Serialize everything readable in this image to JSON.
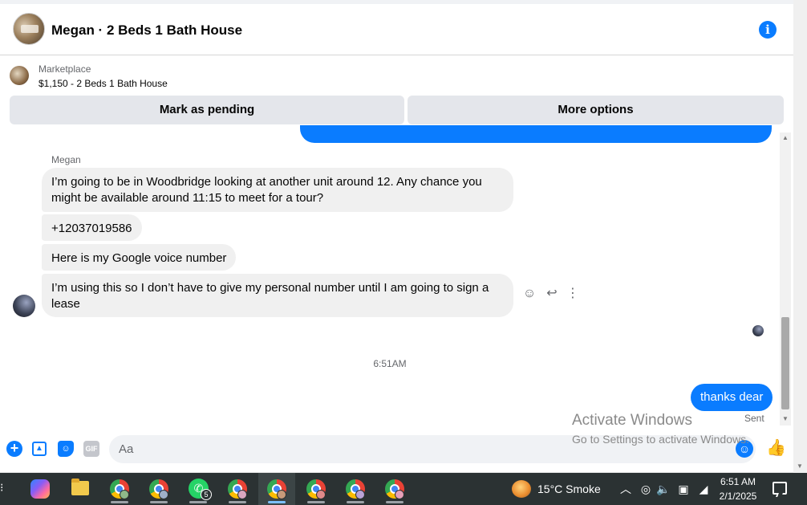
{
  "header": {
    "title": "Megan · 2 Beds 1 Bath House",
    "info_icon": "i"
  },
  "listing": {
    "label": "Marketplace",
    "price_title": "$1,150 - 2 Beds 1 Bath House",
    "mark_pending_label": "Mark as pending",
    "more_options_label": "More options"
  },
  "conversation": {
    "sender_name": "Megan",
    "messages_in": [
      "I’m going to be in Woodbridge looking at another unit around 12. Any chance you might be available around 11:15 to meet for a tour?",
      "+12037019586",
      "Here is my Google voice number",
      "I’m using this so I don’t have to give my personal number until I am going to sign a lease"
    ],
    "timestamp": "6:51AM",
    "message_out": "thanks dear",
    "status": "Sent"
  },
  "composer": {
    "placeholder": "Aa",
    "gif_label": "GIF"
  },
  "watermark": {
    "line1": "Activate Windows",
    "line2": "Go to Settings to activate Windows."
  },
  "taskbar": {
    "whatsapp_count": "5",
    "weather": "15°C  Smoke",
    "time": "6:51 AM",
    "date": "2/1/2025"
  },
  "colors": {
    "accent": "#0a7cff",
    "bubble_in": "#f0f0f0",
    "button_bg": "#e4e6eb",
    "taskbar": "#2b3233"
  }
}
